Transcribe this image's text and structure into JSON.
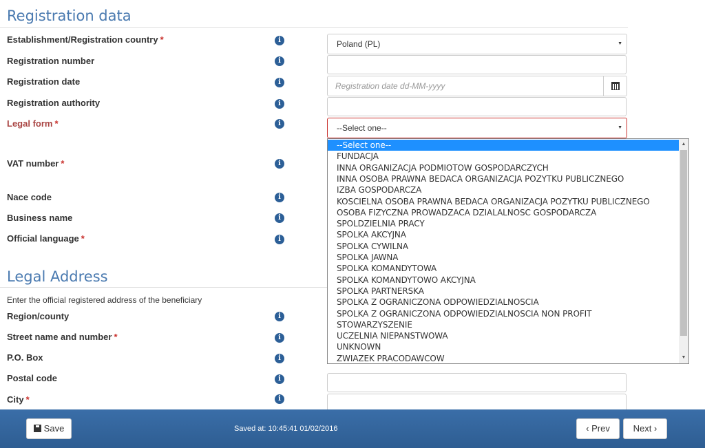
{
  "sections": {
    "registration_title": "Registration data",
    "legal_title": "Legal Address",
    "legal_helper": "Enter the official registered address of the beneficiary"
  },
  "fields": {
    "country": {
      "label": "Establishment/Registration country",
      "value": "Poland (PL)"
    },
    "reg_number": {
      "label": "Registration number"
    },
    "reg_date": {
      "label": "Registration date",
      "placeholder": "Registration date dd-MM-yyyy"
    },
    "reg_authority": {
      "label": "Registration authority"
    },
    "legal_form": {
      "label": "Legal form",
      "value": "--Select one--"
    },
    "vat": {
      "label": "VAT number"
    },
    "nace": {
      "label": "Nace code"
    },
    "business_name": {
      "label": "Business name"
    },
    "official_language": {
      "label": "Official language"
    },
    "region": {
      "label": "Region/county"
    },
    "street": {
      "label": "Street name and number"
    },
    "pobox": {
      "label": "P.O. Box"
    },
    "postal": {
      "label": "Postal code"
    },
    "city": {
      "label": "City"
    }
  },
  "required_mark": "*",
  "info_glyph": "i",
  "legal_form_options": [
    "--Select one--",
    "FUNDACJA",
    "INNA ORGANIZACJA PODMIOTOW GOSPODARCZYCH",
    "INNA OSOBA PRAWNA BEDACA ORGANIZACJA POZYTKU PUBLICZNEGO",
    "IZBA GOSPODARCZA",
    "KOSCIELNA OSOBA PRAWNA BEDACA ORGANIZACJA POZYTKU PUBLICZNEGO",
    "OSOBA FIZYCZNA PROWADZACA DZIALALNOSC GOSPODARCZA",
    "SPOLDZIELNIA PRACY",
    "SPOLKA AKCYJNA",
    "SPOLKA CYWILNA",
    "SPOLKA JAWNA",
    "SPOLKA KOMANDYTOWA",
    "SPOLKA KOMANDYTOWO AKCYJNA",
    "SPOLKA PARTNERSKA",
    "SPOLKA Z OGRANICZONA ODPOWIEDZIALNOSCIA",
    "SPOLKA Z OGRANICZONA ODPOWIEDZIALNOSCIA NON PROFIT",
    "STOWARZYSZENIE",
    "UCZELNIA NIEPANSTWOWA",
    "UNKNOWN",
    "ZWIAZEK PRACODAWCOW"
  ],
  "footer": {
    "save_label": "Save",
    "saved_text": "Saved at: 10:45:41 01/02/2016",
    "prev_label": "Prev",
    "next_label": "Next"
  },
  "colors": {
    "accent": "#4a7ab0",
    "footer": "#2e5d92",
    "error": "#a94442",
    "highlight": "#1e90ff"
  }
}
